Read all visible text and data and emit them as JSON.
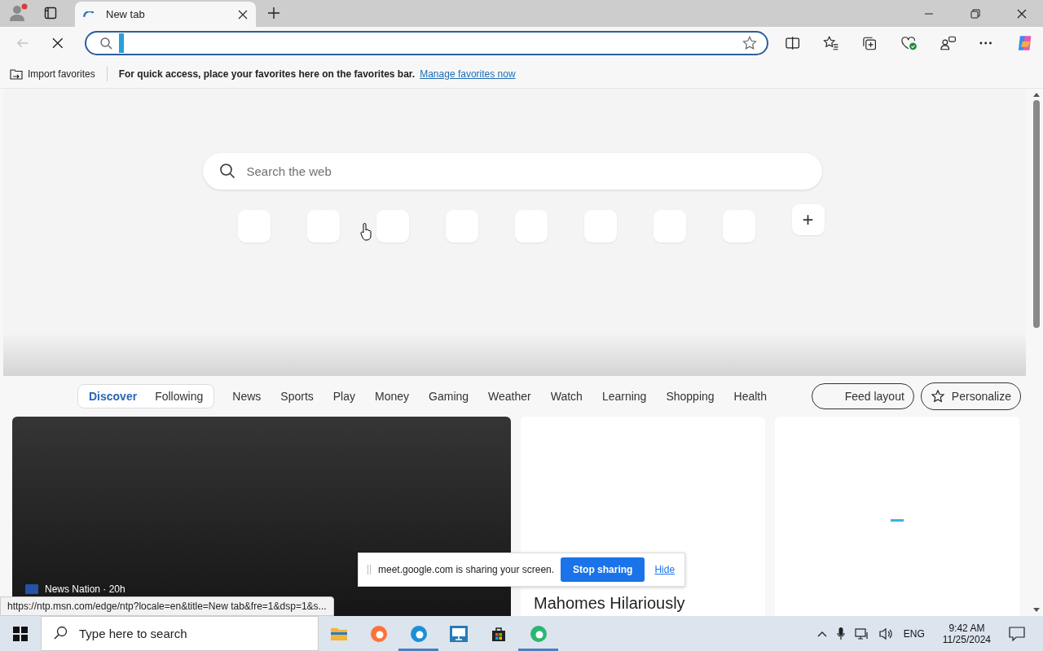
{
  "browser": {
    "tabs": [
      {
        "title": "New tab",
        "selected": true,
        "loading": true
      }
    ],
    "favorites_bar": {
      "import_label": "Import favorites",
      "message": "For quick access, place your favorites here on the favorites bar.",
      "link": "Manage favorites now"
    }
  },
  "new_tab_page": {
    "search": {
      "placeholder": "Search the web"
    },
    "tiles": [
      {
        "kind": "site"
      },
      {
        "kind": "site"
      },
      {
        "kind": "site"
      },
      {
        "kind": "site"
      },
      {
        "kind": "site"
      },
      {
        "kind": "site"
      },
      {
        "kind": "site"
      },
      {
        "kind": "site"
      },
      {
        "kind": "add",
        "label": "+"
      }
    ],
    "feed_tabs": [
      {
        "label": "Discover",
        "selected": true
      },
      {
        "label": "Following",
        "selected": false
      }
    ],
    "categories": [
      "News",
      "Sports",
      "Play",
      "Money",
      "Gaming",
      "Weather",
      "Watch",
      "Learning",
      "Shopping",
      "Health"
    ],
    "feed_buttons": [
      {
        "label": "Feed layout"
      },
      {
        "label": "Personalize"
      }
    ],
    "cards": [
      {
        "kind": "dark",
        "source": "News Nation · 20h"
      },
      {
        "kind": "story",
        "headline": "Mahomes Hilariously"
      },
      {
        "kind": "loading"
      }
    ]
  },
  "share_banner": {
    "message": "meet.google.com is sharing your screen.",
    "stop_label": "Stop sharing",
    "hide_label": "Hide"
  },
  "status_url": "https://ntp.msn.com/edge/ntp?locale=en&title=New tab&fre=1&dsp=1&s...",
  "taskbar": {
    "search_placeholder": "Type here to search",
    "apps": [
      {
        "kind": "folder",
        "running": false
      },
      {
        "kind": "firefox",
        "running": false
      },
      {
        "kind": "edge",
        "running": true
      },
      {
        "kind": "remote",
        "running": false
      },
      {
        "kind": "store",
        "running": false
      },
      {
        "kind": "edge-dev",
        "running": true
      }
    ],
    "language": "ENG",
    "time": "9:42 AM",
    "date": "11/25/2024"
  }
}
